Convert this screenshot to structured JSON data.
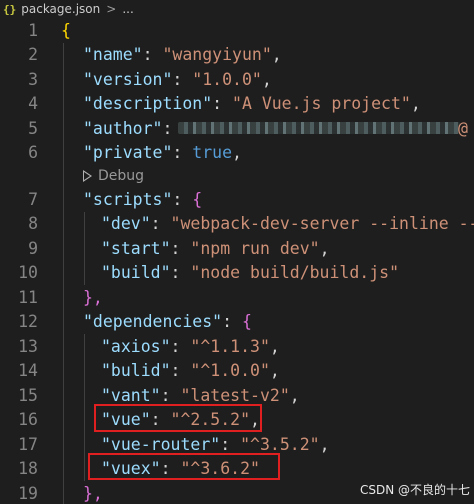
{
  "breadcrumb": {
    "file_icon": "{}",
    "file_name": "package.json",
    "separator": ">",
    "more": "..."
  },
  "editor": {
    "lines": [
      {
        "number": "1",
        "open_brace": "{"
      },
      {
        "number": "2",
        "key": "\"name\"",
        "value": "\"wangyiyun\""
      },
      {
        "number": "3",
        "key": "\"version\"",
        "value": "\"1.0.0\""
      },
      {
        "number": "4",
        "key": "\"description\"",
        "value": "\"A Vue.js project\""
      },
      {
        "number": "5",
        "key": "\"author\"",
        "value_tail": "@"
      },
      {
        "number": "6",
        "key": "\"private\"",
        "value": "true"
      },
      {
        "codelens": "Debug"
      },
      {
        "number": "7",
        "key": "\"scripts\"",
        "open_brace": "{"
      },
      {
        "number": "8",
        "key": "\"dev\"",
        "value": "\"webpack-dev-server --inline --"
      },
      {
        "number": "9",
        "key": "\"start\"",
        "value": "\"npm run dev\""
      },
      {
        "number": "10",
        "key": "\"build\"",
        "value": "\"node build/build.js\""
      },
      {
        "number": "11",
        "close": "},"
      },
      {
        "number": "12",
        "key": "\"dependencies\"",
        "open_brace": "{"
      },
      {
        "number": "13",
        "key": "\"axios\"",
        "value": "\"^1.1.3\""
      },
      {
        "number": "14",
        "key": "\"bulid\"",
        "value": "\"^1.0.0\""
      },
      {
        "number": "15",
        "key": "\"vant\"",
        "value": "\"latest-v2\""
      },
      {
        "number": "16",
        "key": "\"vue\"",
        "value": "\"^2.5.2\""
      },
      {
        "number": "17",
        "key": "\"vue-router\"",
        "value": "\"^3.5.2\""
      },
      {
        "number": "18",
        "key": "\"vuex\"",
        "value": "\"^3.6.2\""
      },
      {
        "number": "19",
        "close": "},"
      }
    ]
  },
  "watermark": "CSDN @不良的十七",
  "colors": {
    "background": "#1e1e1e",
    "key": "#9cdcfe",
    "string": "#ce9178",
    "keyword": "#569cd6",
    "brace_level1": "#ffd700",
    "brace_level2": "#da70d6",
    "line_number": "#858585",
    "highlight_box": "#e02020"
  }
}
